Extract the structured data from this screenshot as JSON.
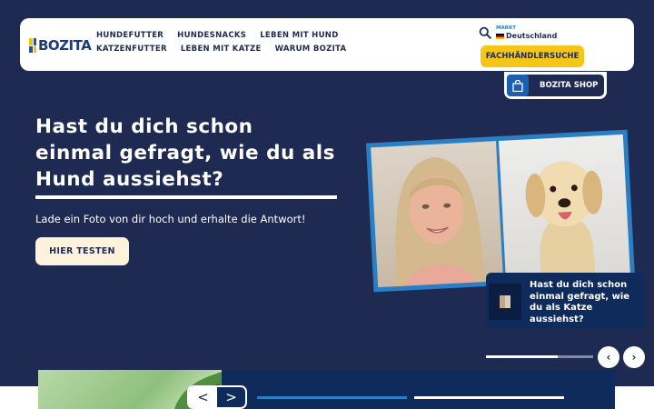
{
  "brand": {
    "name": "BOZITA"
  },
  "nav": {
    "items": [
      "HUNDEFUTTER",
      "HUNDESNACKS",
      "LEBEN MIT HUND",
      "KATZENFUTTER",
      "LEBEN MIT KATZE",
      "WARUM BOZITA"
    ]
  },
  "market": {
    "label": "MARKT",
    "value": "Deutschland"
  },
  "dealer": {
    "label": "FACHHÄNDLERSUCHE"
  },
  "shop": {
    "label": "BOZITA SHOP"
  },
  "hero": {
    "headline": "Hast du dich schon einmal gefragt, wie du als Hund aussiehst?",
    "subline": "Lade ein Foto von dir hoch und erhalte die Antwort!",
    "cta": "HIER TESTEN"
  },
  "next_slide": {
    "title": "Hast du dich schon einmal gefragt, wie du als Katze aussiehst?"
  },
  "carousel": {
    "progress": 0.67,
    "prev": "‹",
    "next": "›"
  },
  "bottom_nav": {
    "prev": "<",
    "next": ">"
  },
  "colors": {
    "navy": "#1e2a52",
    "yellow": "#f5c518",
    "blue": "#2a7fc4",
    "cream": "#fdf3dc"
  }
}
